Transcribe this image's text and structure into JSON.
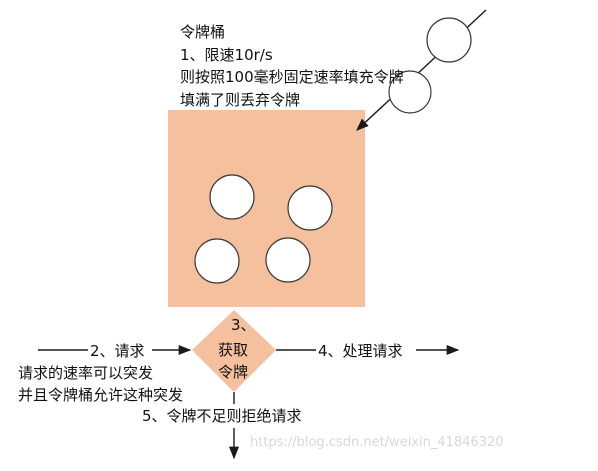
{
  "bucket": {
    "title": "令牌桶",
    "rule_line1": "1、限速10r/s",
    "rule_line2": "则按照100毫秒固定速率填充令牌",
    "rule_line3": "填满了则丢弃令牌",
    "fill_color": "#f5c09d",
    "tokens_inside": 4,
    "tokens_falling": 2
  },
  "decision": {
    "line1": "3、",
    "line2": "获取",
    "line3": "令牌",
    "fill_color": "#f5c09d"
  },
  "request": {
    "label": "2、请求",
    "note_line1": "请求的速率可以突发",
    "note_line2": "并且令牌桶允许这种突发"
  },
  "process": {
    "label": "4、处理请求"
  },
  "reject": {
    "label": "5、令牌不足则拒绝请求"
  },
  "watermark": "https://blog.csdn.net/weixin_41846320"
}
